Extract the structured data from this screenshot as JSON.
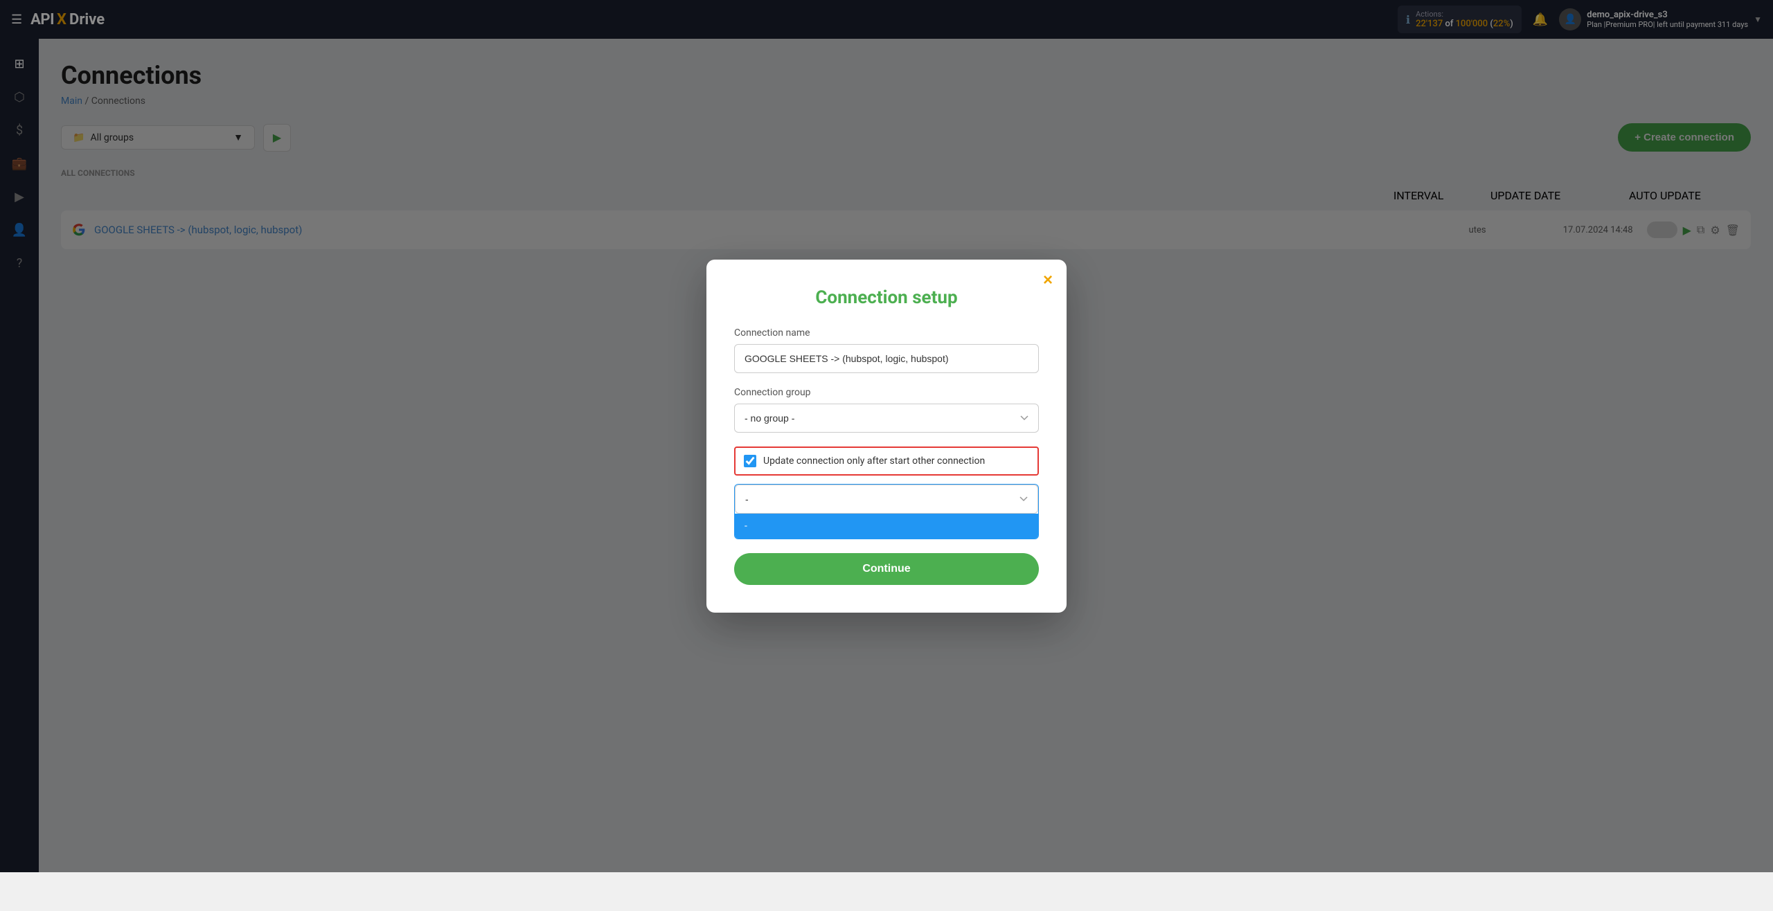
{
  "navbar": {
    "logo_api": "API",
    "logo_x": "X",
    "logo_drive": "Drive",
    "hamburger_label": "☰",
    "actions_label": "Actions:",
    "actions_count": "22'137",
    "actions_total": "100'000",
    "actions_percent": "22%",
    "bell_icon": "🔔",
    "user_name": "demo_apix-drive_s3",
    "plan_label": "Plan |Premium PRO| left until payment",
    "plan_days": "311 days",
    "chevron": "▼"
  },
  "sidebar": {
    "items": [
      {
        "icon": "⊞",
        "label": "dashboard-icon"
      },
      {
        "icon": "⬡",
        "label": "connections-icon"
      },
      {
        "icon": "$",
        "label": "billing-icon"
      },
      {
        "icon": "💼",
        "label": "integrations-icon"
      },
      {
        "icon": "▶",
        "label": "play-icon"
      },
      {
        "icon": "👤",
        "label": "profile-icon"
      },
      {
        "icon": "?",
        "label": "help-icon"
      }
    ]
  },
  "page": {
    "title": "Connections",
    "breadcrumb_main": "Main",
    "breadcrumb_separator": " / ",
    "breadcrumb_current": "Connections",
    "all_connections_label": "ALL CONNECTIONS",
    "group_selector_label": "All groups",
    "create_button": "+ Create connection",
    "table_headers": {
      "interval": "INTERVAL",
      "update_date": "UPDATE DATE",
      "auto_update": "AUTO UPDATE"
    },
    "connection_row": {
      "name": "GOOGLE SHEETS -> (hubspot, logic, hubspot)",
      "date": "17.07.2024 14:48"
    }
  },
  "modal": {
    "title": "Connection setup",
    "close_label": "×",
    "connection_name_label": "Connection name",
    "connection_name_value": "GOOGLE SHEETS -> (hubspot, logic, hubspot)",
    "connection_group_label": "Connection group",
    "connection_group_value": "- no group -",
    "checkbox_label": "Update connection only after start other connection",
    "checkbox_checked": true,
    "dropdown_value": "-",
    "dropdown_selected_value": "-",
    "continue_button": "Continue",
    "group_options": [
      "- no group -"
    ],
    "connection_options": [
      "-"
    ]
  }
}
